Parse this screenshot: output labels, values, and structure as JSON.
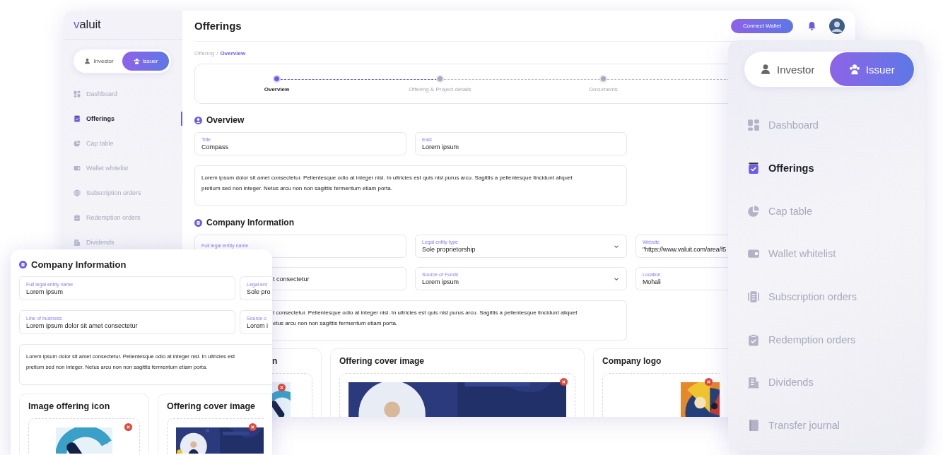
{
  "main_window": {
    "logo": "valuit",
    "role_toggle": [
      {
        "label": "Investor",
        "selected": false
      },
      {
        "label": "Issuer",
        "selected": true
      }
    ],
    "sidebar": [
      {
        "label": "Dashboard",
        "selected": false
      },
      {
        "label": "Offerings",
        "selected": true
      },
      {
        "label": "Cap table",
        "selected": false
      },
      {
        "label": "Wallet whitelist",
        "selected": false
      },
      {
        "label": "Subscription orders",
        "selected": false
      },
      {
        "label": "Redemption orders",
        "selected": false
      },
      {
        "label": "Dividends",
        "selected": false
      }
    ],
    "header": {
      "title": "Offerings",
      "connect_button": "Connect Wallet"
    },
    "breadcrumb": {
      "parent": "Offering",
      "separator": "/",
      "current": "Overview"
    },
    "stepper": [
      {
        "label": "Overview",
        "selected": true
      },
      {
        "label": "Offering & Project details",
        "selected": false
      },
      {
        "label": "Documents",
        "selected": false
      }
    ],
    "overview": {
      "title": "Overview",
      "fields": [
        {
          "label": "Title",
          "value": "Compass",
          "kind": "text"
        },
        {
          "label": "East",
          "value": "Lorem ipsum",
          "kind": "text"
        }
      ],
      "description": {
        "kind": "full",
        "lines": [
          "Lorem ipsum dolor sit amet consectetur. Pellentesque odio at integer nisl. In ultricies est quis nisl purus arcu. Sagittis a pellentesque tincidunt aliquet",
          "pretium sed non integer. Netus arcu non non sagittis fermentum etiam porta."
        ]
      }
    },
    "company": {
      "title": "Company Information",
      "fields": [
        {
          "label": "Full legal entity name",
          "kind": "text"
        },
        {
          "label": "Legal entity type",
          "value": "Sole proprietorship",
          "kind": "select"
        },
        {
          "label": "Website",
          "value": "\"https://www.valuit.com/area/f5",
          "kind": "text"
        },
        {
          "value": "t consectetur",
          "kind": "covered"
        },
        {
          "label": "Source of Funds",
          "value": "Lorem ipsum",
          "kind": "select"
        },
        {
          "label": "Location",
          "value": "Mohali",
          "kind": "text"
        }
      ],
      "description": {
        "kind": "covered",
        "lines": [
          "t consectetur. Pellentesque odio at integer nisl. In ultricies est quis nisl purus arcu. Sagittis a pellentesque tincidunt aliquet",
          "etus arcu non non sagittis fermentum etiam porta."
        ]
      },
      "image_cards": [
        {
          "title": "n",
          "kind": "covered"
        },
        {
          "title": "Offering cover image",
          "kind": "plain"
        },
        {
          "title": "Company logo",
          "kind": "plain"
        }
      ]
    }
  },
  "company_card": {
    "title": "Company Information",
    "fields": [
      {
        "label": "Full legal entity name",
        "value": "Lorem ipsum",
        "kind": "text"
      },
      {
        "label": "Legal ent",
        "value": "Sole pro",
        "kind": "text"
      },
      {
        "label": "Line of business",
        "value": "Lorem ipsum dolor sit amet consectetur",
        "kind": "text"
      },
      {
        "label": "Source o",
        "value": "Lorem i",
        "kind": "text"
      }
    ],
    "description": {
      "kind": "full",
      "lines": [
        "Lorem ipsum dolor sit amet consectetur. Pellentesque odio at integer nisl. In ultricies est",
        "pretium sed non integer. Netus arcu non non sagittis fermentum etiam porta."
      ]
    },
    "image_cards": [
      {
        "title": "Image offering icon",
        "kind": "plain"
      },
      {
        "title": "Offering cover image",
        "kind": "plain"
      }
    ]
  },
  "side_panel": {
    "role_toggle": [
      {
        "label": "Investor",
        "selected": false
      },
      {
        "label": "Issuer",
        "selected": true
      }
    ],
    "items": [
      {
        "label": "Dashboard",
        "selected": false
      },
      {
        "label": "Offerings",
        "selected": true
      },
      {
        "label": "Cap table",
        "selected": false
      },
      {
        "label": "Wallet whitelist",
        "selected": false
      },
      {
        "label": "Subscription orders",
        "selected": false
      },
      {
        "label": "Redemption orders",
        "selected": false
      },
      {
        "label": "Dividends",
        "selected": false
      },
      {
        "label": "Transfer journal",
        "selected": false
      }
    ]
  }
}
